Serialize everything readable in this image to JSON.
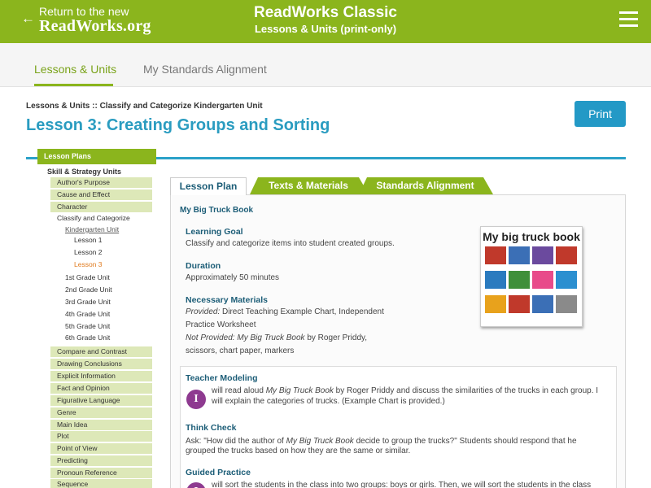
{
  "header": {
    "back_line1": "Return to the new",
    "back_line2": "ReadWorks.org",
    "back_arrow": "←",
    "title": "ReadWorks Classic",
    "subtitle": "Lessons & Units (print-only)",
    "menu_icon": "hamburger-icon"
  },
  "nav": {
    "tabs": [
      {
        "label": "Lessons & Units",
        "active": true
      },
      {
        "label": "My Standards Alignment",
        "active": false
      }
    ]
  },
  "page": {
    "breadcrumb": "Lessons & Units :: Classify and Categorize Kindergarten Unit",
    "title": "Lesson 3: Creating Groups and Sorting",
    "print_label": "Print"
  },
  "sidebar": {
    "heading": "Lesson Plans",
    "section": "Skill & Strategy Units",
    "items_top": [
      "Author's Purpose",
      "Cause and Effect",
      "Character"
    ],
    "classify": "Classify and Categorize",
    "kinder_unit": "Kindergarten Unit",
    "lessons": [
      "Lesson 1",
      "Lesson 2",
      "Lesson 3"
    ],
    "grades": [
      "1st Grade Unit",
      "2nd Grade Unit",
      "3rd Grade Unit",
      "4th Grade Unit",
      "5th Grade Unit",
      "6th Grade Unit"
    ],
    "items_bottom": [
      "Compare and Contrast",
      "Drawing Conclusions",
      "Explicit Information",
      "Fact and Opinion",
      "Figurative Language",
      "Genre",
      "Main Idea",
      "Plot",
      "Point of View",
      "Predicting",
      "Pronoun Reference",
      "Sequence"
    ]
  },
  "content_tabs": [
    "Lesson Plan",
    "Texts & Materials",
    "Standards Alignment"
  ],
  "lesson": {
    "book_title": "My Big Truck Book",
    "goal_h": "Learning Goal",
    "goal_t": "Classify and categorize items into student created groups.",
    "duration_h": "Duration",
    "duration_t": "Approximately 50 minutes",
    "materials_h": "Necessary Materials",
    "provided_label": "Provided:",
    "provided_t1": " Direct Teaching Example Chart, Independent",
    "provided_t2": "Practice Worksheet",
    "notprov_label": "Not Provided: My Big Truck Book",
    "notprov_rest": " by Roger Priddy,",
    "notprov_t2": "scissors, chart paper, markers",
    "cover_title": "My big truck book"
  },
  "steps": {
    "modeling_h": "Teacher Modeling",
    "badge": "I",
    "modeling_pre": "will read aloud ",
    "modeling_book": "My Big Truck Book",
    "modeling_post": " by Roger Priddy and discuss the similarities of the trucks in each group. I",
    "modeling_l2": "will explain the categories of trucks. (Example Chart is provided.)",
    "think_h": "Think Check",
    "think_pre": "Ask: \"How did the author of ",
    "think_book": "My Big Truck Book",
    "think_post": " decide to group the trucks?\" Students should respond that he",
    "think_l2": "grouped the trucks based on how they are the same or similar.",
    "guided_h": "Guided Practice",
    "guided_l1": "will sort the students in the class into two groups: boys or girls. Then, we will sort the students in the class"
  },
  "colors": {
    "brand_green": "#8bb51d",
    "title_blue": "#2a9cc0",
    "print_blue": "#2399c6",
    "badge_purple": "#8e3a90",
    "current_orange": "#e07b1f"
  }
}
